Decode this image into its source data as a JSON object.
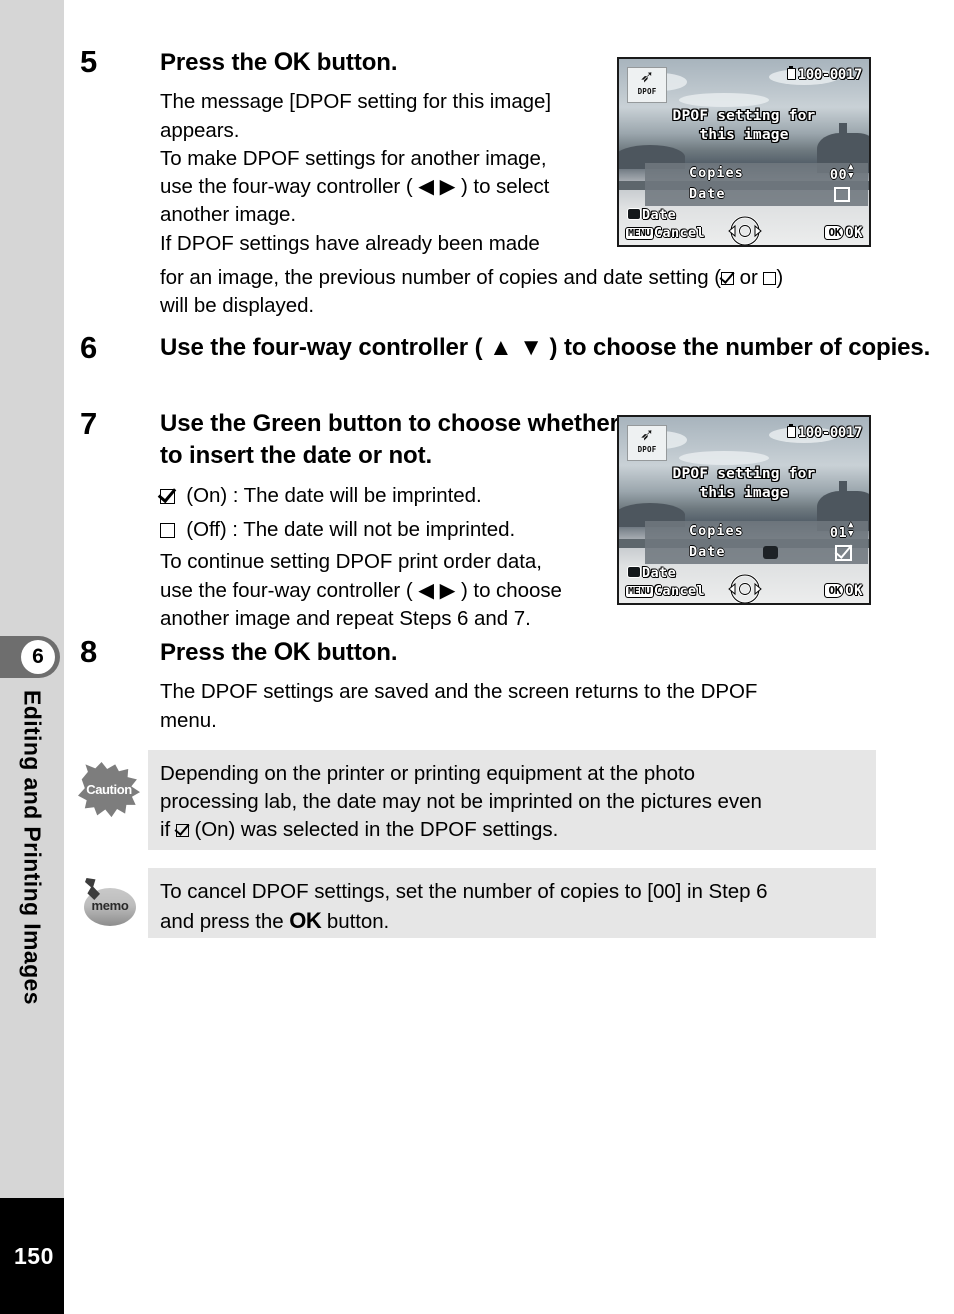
{
  "page": {
    "number": "150",
    "chapter_number": "6",
    "chapter_title": "Editing and Printing Images"
  },
  "steps": [
    {
      "number": "5",
      "heading_pre": "Press the ",
      "heading_ok": "OK",
      "heading_post": " button.",
      "body_lines": [
        "The message [DPOF setting for this image]",
        "appears.",
        "To make DPOF settings for another image,",
        "use the four-way controller ( ◀ ▶ ) to select",
        "another image.",
        "If DPOF settings have already been made"
      ],
      "body_wide_pre": "for an image, the previous number of copies and date setting (",
      "body_wide_mid": " or ",
      "body_wide_post": ")",
      "body_wide_tail": "will be displayed."
    },
    {
      "number": "6",
      "heading": "Use the four-way controller ( ▲ ▼ ) to choose the number of copies."
    },
    {
      "number": "7",
      "heading": "Use the Green button to choose whether to insert the date or not.",
      "on_label": "(On) :  The date will be imprinted.",
      "off_label": "(Off) :  The date will not be imprinted.",
      "body_lines": [
        "To continue setting DPOF print order data,",
        "use the four-way controller ( ◀ ▶ ) to choose",
        "another image and repeat Steps 6 and 7."
      ]
    },
    {
      "number": "8",
      "heading_pre": "Press the ",
      "heading_ok": "OK",
      "heading_post": " button.",
      "body_lines": [
        "The DPOF settings are saved and the screen returns to the DPOF",
        "menu."
      ]
    }
  ],
  "lcd_top": {
    "dpof_badge_label": "DPOF",
    "file_number": "100-0017",
    "message_line1": "DPOF setting for",
    "message_line2": "this image",
    "copies_label": "Copies",
    "copies_value": "00",
    "date_label": "Date",
    "date_checked": false,
    "green_button_shown": false,
    "foot_date": "Date",
    "foot_menu_key": "MENU",
    "foot_cancel": "Cancel",
    "foot_ok_key": "OK",
    "foot_ok": "OK"
  },
  "lcd_bottom": {
    "dpof_badge_label": "DPOF",
    "file_number": "100-0017",
    "message_line1": "DPOF setting for",
    "message_line2": "this image",
    "copies_label": "Copies",
    "copies_value": "01",
    "date_label": "Date",
    "date_checked": true,
    "green_button_shown": true,
    "foot_date": "Date",
    "foot_menu_key": "MENU",
    "foot_cancel": "Cancel",
    "foot_ok_key": "OK",
    "foot_ok": "OK"
  },
  "caution_note": {
    "icon_label": "Caution",
    "line1": "Depending on the printer or printing equipment at the photo",
    "line2": "processing lab, the date may not be imprinted on the pictures even",
    "line3_pre": "if ",
    "line3_post": " (On) was selected in the DPOF settings."
  },
  "memo_note": {
    "icon_label": "memo",
    "line1": "To cancel DPOF settings, set the number of copies to [00] in Step 6",
    "line2_pre": "and press the ",
    "line2_ok": "OK",
    "line2_post": " button."
  }
}
